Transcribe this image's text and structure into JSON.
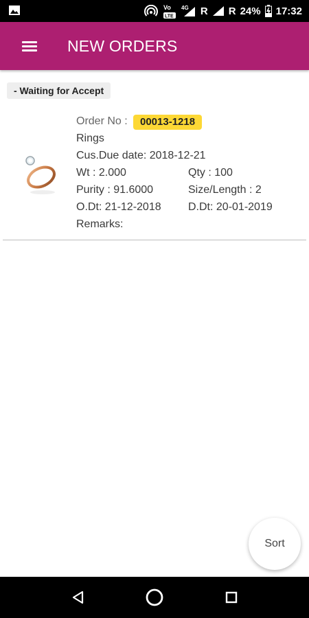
{
  "status_bar": {
    "battery": "24%",
    "time": "17:32",
    "network_r1": "R",
    "network_r2": "R",
    "volte": "VoLTE",
    "lte_4g": "4G",
    "icons": [
      "image-icon",
      "hotspot-icon",
      "volte-icon",
      "signal-icon",
      "signal-icon",
      "battery-icon"
    ]
  },
  "app_bar": {
    "title": "NEW ORDERS",
    "menu_icon": "hamburger-menu-icon",
    "color": "#ad1f71"
  },
  "section": {
    "label": "- Waiting for Accept"
  },
  "order": {
    "order_no_label": "Order No :",
    "order_no": "00013-1218",
    "product": "Rings",
    "cus_due_date": "Cus.Due date: 2018-12-21",
    "wt": "Wt : 2.000",
    "qty": "Qty : 100",
    "purity": "Purity : 91.6000",
    "size_length": "Size/Length : 2",
    "o_dt": "O.Dt: 21-12-2018",
    "d_dt": "D.Dt: 20-01-2019",
    "remarks": "Remarks:",
    "badge_color": "#fdd835",
    "image_icon": "ring-image"
  },
  "fab": {
    "label": "Sort"
  },
  "nav_bar": {
    "icons": [
      "back-icon",
      "home-icon",
      "recent-apps-icon"
    ]
  }
}
